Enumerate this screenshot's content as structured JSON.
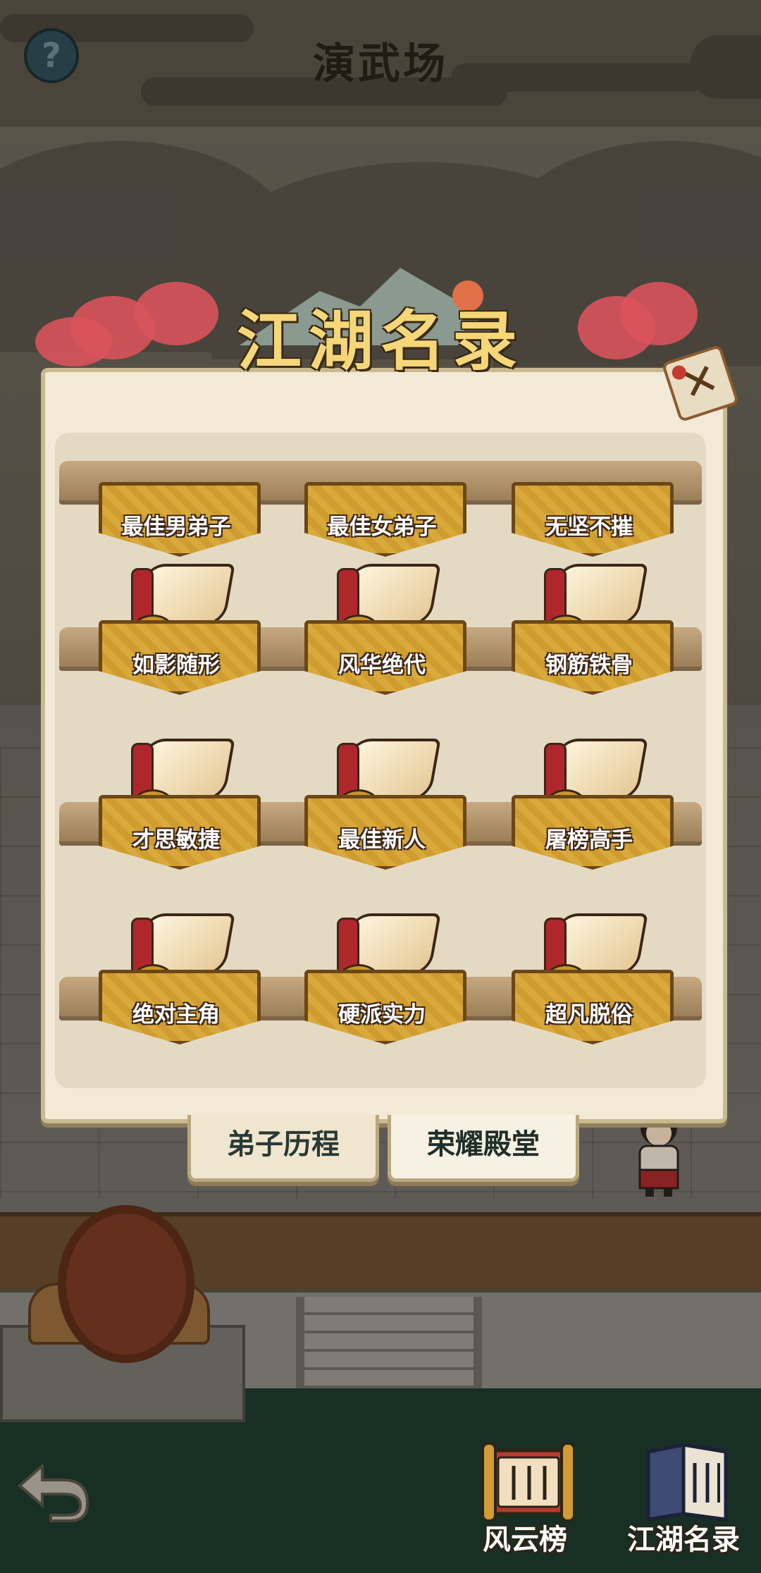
{
  "header": {
    "title": "演武场",
    "help_label": "?"
  },
  "dialog": {
    "title": "江湖名录",
    "close_label": "✕",
    "awards": [
      "最佳男弟子",
      "最佳女弟子",
      "无坚不摧",
      "如影随形",
      "风华绝代",
      "钢筋铁骨",
      "才思敏捷",
      "最佳新人",
      "屠榜高手",
      "绝对主角",
      "硬派实力",
      "超凡脱俗"
    ],
    "tabs": [
      {
        "label": "弟子历程",
        "active": false
      },
      {
        "label": "荣耀殿堂",
        "active": true
      }
    ]
  },
  "bottom": {
    "leaderboard_label": "风云榜",
    "directory_label": "江湖名录"
  },
  "colors": {
    "dialog_bg": "#f2ead7",
    "panel_bg": "#e4dac4",
    "plaque_gold": "#d9a93c",
    "title_gold": "#f5d77a",
    "ribbon_red": "#b0272b"
  }
}
